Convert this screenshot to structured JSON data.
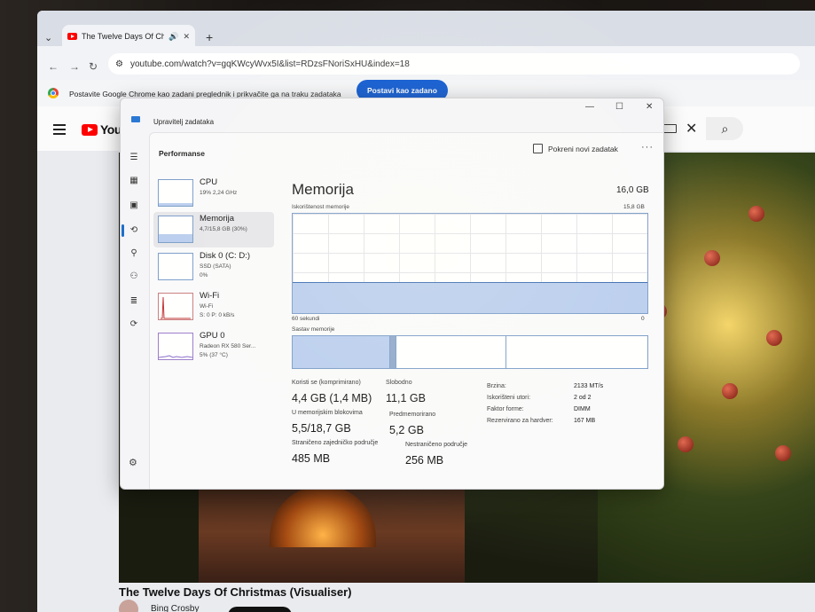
{
  "browser": {
    "tab_title": "The Twelve Days Of Christmas",
    "url": "youtube.com/watch?v=gqKWcyWvx5I&list=RDzsFNoriSxHU&index=18",
    "infobar_text": "Postavite Google Chrome kao zadani preglednik i prikvačite ga na traku zadataka",
    "infobar_button": "Postavi kao zadano"
  },
  "youtube": {
    "logo_text": "YouT",
    "video_title": "The Twelve Days Of Christmas (Visualiser)",
    "channel_name": "Bing Crosby"
  },
  "taskmanager": {
    "window_title": "Upravitelj zadataka",
    "section": "Performanse",
    "run_task": "Pokreni novi zadatak",
    "side": [
      {
        "name": "CPU",
        "sub1": "19% 2,24 GHz",
        "sub2": "",
        "sub3": ""
      },
      {
        "name": "Memorija",
        "sub1": "4,7/15,8 GB (30%)",
        "sub2": "",
        "sub3": ""
      },
      {
        "name": "Disk 0 (C: D:)",
        "sub1": "SSD (SATA)",
        "sub2": "0%",
        "sub3": ""
      },
      {
        "name": "Wi-Fi",
        "sub1": "Wi-Fi",
        "sub2": "S: 0 P: 0 kB/s",
        "sub3": ""
      },
      {
        "name": "GPU 0",
        "sub1": "Radeon RX 580 Ser...",
        "sub2": "5% (37 °C)",
        "sub3": ""
      }
    ],
    "memory": {
      "title": "Memorija",
      "total": "16,0 GB",
      "usage_label": "Iskorištenost memorije",
      "usage_max": "15,8 GB",
      "usage_fraction": 0.3,
      "time_left": "60 sekundi",
      "time_right": "0",
      "composition_label": "Sastav memorije",
      "in_use_label": "Koristi se (komprimirano)",
      "in_use_value": "4,4 GB (1,4 MB)",
      "available_label": "Slobodno",
      "available_value": "11,1 GB",
      "committed_label": "U memorijskim blokovima",
      "committed_value": "5,5/18,7 GB",
      "cached_label": "Predmemorirano",
      "cached_value": "5,2 GB",
      "paged_label": "Straničeno zajedničko područje",
      "paged_value": "485 MB",
      "nonpaged_label": "Nestraničeno područje",
      "nonpaged_value": "256 MB",
      "speed_label": "Brzina:",
      "speed_value": "2133 MT/s",
      "slots_label": "Iskorišteni utori:",
      "slots_value": "2 od 2",
      "form_label": "Faktor forme:",
      "form_value": "DIMM",
      "reserved_label": "Rezervirano za hardver:",
      "reserved_value": "167 MB"
    }
  }
}
